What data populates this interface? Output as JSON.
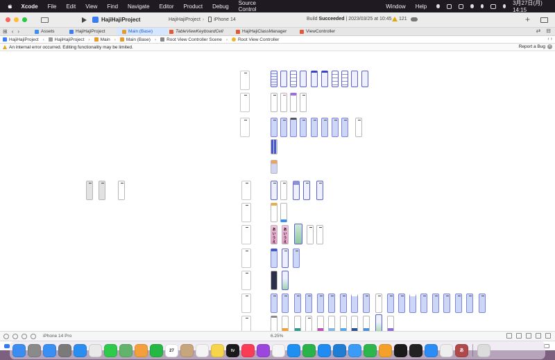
{
  "menubar": {
    "items": [
      "Xcode",
      "File",
      "Edit",
      "View",
      "Find",
      "Navigate",
      "Editor",
      "Product",
      "Debug",
      "Source Control",
      "Window",
      "Help"
    ],
    "clock": "3月27日(月) 14:15"
  },
  "toolbar": {
    "project": "HajiHajiProject",
    "scheme": "HajiHajiProject",
    "device": "iPhone 14",
    "status_prefix": "Build",
    "status_bold": "Succeeded",
    "status_suffix": "| 2023/03/25 at 10:45",
    "warnings": "121"
  },
  "tabs": [
    {
      "label": "Assets"
    },
    {
      "label": "HajiHajiProject"
    },
    {
      "label": "Main (Base)"
    },
    {
      "label": "TableViewKeyboardCell"
    },
    {
      "label": "HajiHajiClassManager"
    },
    {
      "label": "ViewController"
    }
  ],
  "jumpbar": {
    "crumbs": [
      "HajiHajiProject",
      "HajiHajiProject",
      "Main",
      "Main (Base)",
      "Root View Controller Scene",
      "Root View Controller"
    ]
  },
  "errorbar": {
    "message": "An internal error occurred. Editing functionality may be limited.",
    "report": "Report a Bug"
  },
  "bottombar": {
    "device": "iPhone 14 Pro",
    "zoom": "6.25%"
  },
  "colors": {
    "accent": "#2f7cf6",
    "selected_tab_bg": "#d6e6ff",
    "warning": "#e2a90c"
  },
  "dock": {
    "apps": [
      {
        "icon": "finder-icon",
        "color": "#3b8df0"
      },
      {
        "icon": "launchpad-icon",
        "color": "#8a8a8a"
      },
      {
        "icon": "mail-icon",
        "color": "#3a8ff5"
      },
      {
        "icon": "settings-icon",
        "color": "#7a7a7a"
      },
      {
        "icon": "safari-icon",
        "color": "#2a8ef0"
      },
      {
        "icon": "chrome-icon",
        "color": "#e9e9e9"
      },
      {
        "icon": "messages-icon",
        "color": "#2fca4c"
      },
      {
        "icon": "maps-icon",
        "color": "#63b36b"
      },
      {
        "icon": "photos-icon",
        "color": "#f3a03a"
      },
      {
        "icon": "facetime-icon",
        "color": "#26b844"
      },
      {
        "icon": "calendar-icon",
        "color": "#ffffff",
        "text": "27"
      },
      {
        "icon": "contacts-icon",
        "color": "#c8a67d"
      },
      {
        "icon": "reminders-icon",
        "color": "#f4f4f4"
      },
      {
        "icon": "notes-icon",
        "color": "#f6d54a"
      },
      {
        "icon": "tv-icon",
        "color": "#1a1a1a",
        "text": "tv"
      },
      {
        "icon": "music-icon",
        "color": "#fa3c55"
      },
      {
        "icon": "podcasts-icon",
        "color": "#9b47dd"
      },
      {
        "icon": "news-icon",
        "color": "#f5f5f5"
      },
      {
        "icon": "keynote-icon",
        "color": "#1f8ff2"
      },
      {
        "icon": "numbers-icon",
        "color": "#29b34a"
      },
      {
        "icon": "appstore-icon",
        "color": "#1e8cf2"
      },
      {
        "icon": "vscode-icon",
        "color": "#1f7ed4"
      },
      {
        "icon": "xcode-icon",
        "color": "#3a9cf7"
      },
      {
        "icon": "numbers2-icon",
        "color": "#2db64b"
      },
      {
        "icon": "pages-icon",
        "color": "#f4a12a"
      },
      {
        "icon": "slack-icon",
        "color": "#1a1a1a"
      },
      {
        "icon": "terminal-icon",
        "color": "#222222"
      },
      {
        "icon": "zoom-icon",
        "color": "#2b8cf6"
      },
      {
        "icon": "preview-icon",
        "color": "#eeeeee"
      },
      {
        "icon": "kana-icon",
        "color": "#b04a4a",
        "text": "あ"
      },
      {
        "icon": "trash-icon",
        "color": "#dcdcdc"
      }
    ]
  }
}
